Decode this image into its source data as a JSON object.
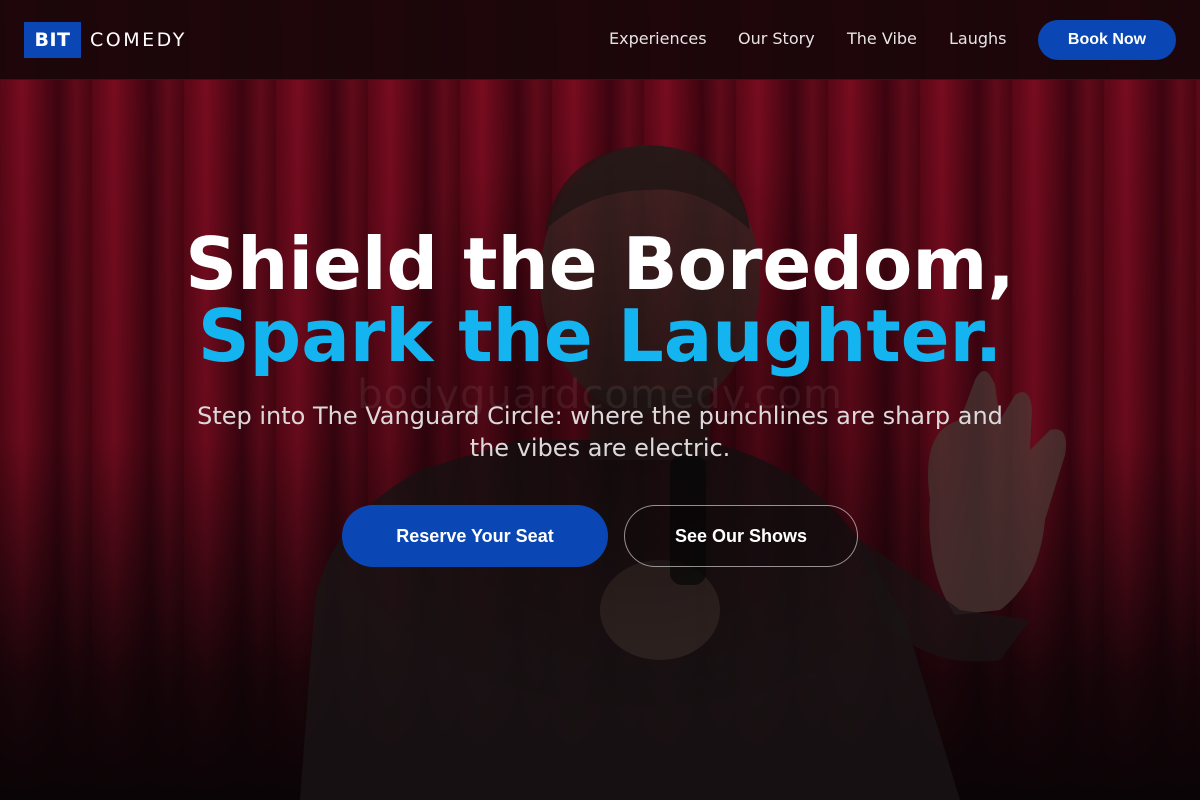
{
  "brand": {
    "logo_box": "BIT",
    "logo_text": "COMEDY"
  },
  "nav": {
    "items": [
      {
        "label": "Experiences"
      },
      {
        "label": "Our Story"
      },
      {
        "label": "The Vibe"
      },
      {
        "label": "Laughs"
      }
    ],
    "cta_label": "Book Now"
  },
  "hero": {
    "headline_line1": "Shield the Boredom,",
    "headline_line2": "Spark the Laughter.",
    "subtitle": "Step into The Vanguard Circle: where the punchlines are sharp and the vibes are electric.",
    "primary_button": "Reserve Your Seat",
    "secondary_button": "See Our Shows",
    "watermark": "bodyguardcomedy.com"
  },
  "colors": {
    "accent_blue": "#0a47b4",
    "headline_accent": "#13b4f0",
    "curtain_red": "#6a0a1c"
  }
}
